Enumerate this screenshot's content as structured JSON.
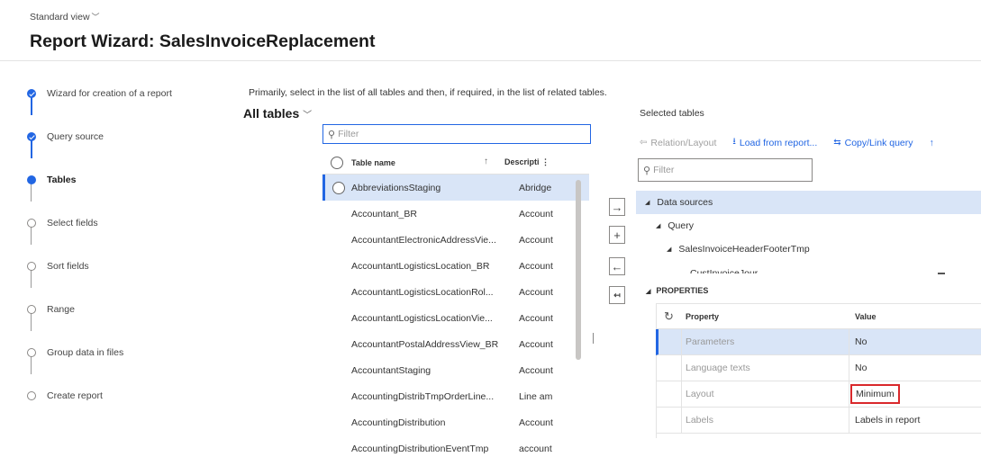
{
  "header": {
    "view_label": "Standard view",
    "title": "Report Wizard: SalesInvoiceReplacement"
  },
  "steps": [
    {
      "label": "Wizard for creation of a report",
      "state": "done"
    },
    {
      "label": "Query source",
      "state": "done"
    },
    {
      "label": "Tables",
      "state": "current"
    },
    {
      "label": "Select fields",
      "state": "todo"
    },
    {
      "label": "Sort fields",
      "state": "todo"
    },
    {
      "label": "Range",
      "state": "todo"
    },
    {
      "label": "Group data in files",
      "state": "todo"
    },
    {
      "label": "Create report",
      "state": "todo"
    }
  ],
  "tables": {
    "instructions": "Primarily, select in the list of all tables and then, if required, in the list of related tables.",
    "all_tables_label": "All tables",
    "filter_placeholder": "Filter",
    "col_name": "Table name",
    "col_desc": "Descripti",
    "rows": [
      {
        "name": "AbbreviationsStaging",
        "desc": "Abridge"
      },
      {
        "name": "Accountant_BR",
        "desc": "Account"
      },
      {
        "name": "AccountantElectronicAddressVie...",
        "desc": "Account"
      },
      {
        "name": "AccountantLogisticsLocation_BR",
        "desc": "Account"
      },
      {
        "name": "AccountantLogisticsLocationRol...",
        "desc": "Account"
      },
      {
        "name": "AccountantLogisticsLocationVie...",
        "desc": "Account"
      },
      {
        "name": "AccountantPostalAddressView_BR",
        "desc": "Account"
      },
      {
        "name": "AccountantStaging",
        "desc": "Account"
      },
      {
        "name": "AccountingDistribTmpOrderLine...",
        "desc": "Line am"
      },
      {
        "name": "AccountingDistribution",
        "desc": "Account"
      },
      {
        "name": "AccountingDistributionEventTmp",
        "desc": "account"
      }
    ]
  },
  "move_buttons": {
    "add": "→",
    "add_all": "+",
    "remove": "←",
    "remove_all": "↤"
  },
  "selected": {
    "label": "Selected tables",
    "toolbar": {
      "relation_layout": "Relation/Layout",
      "load_from_report": "Load from report...",
      "copy_link_query": "Copy/Link query"
    },
    "filter_placeholder": "Filter",
    "tree": {
      "data_sources": "Data sources",
      "query": "Query",
      "table": "SalesInvoiceHeaderFooterTmp",
      "child": "CustInvoiceJour"
    }
  },
  "properties": {
    "title": "PROPERTIES",
    "col_property": "Property",
    "col_value": "Value",
    "rows": [
      {
        "name": "Parameters",
        "value": "No"
      },
      {
        "name": "Language texts",
        "value": "No"
      },
      {
        "name": "Layout",
        "value": "Minimum"
      },
      {
        "name": "Labels",
        "value": "Labels in report"
      }
    ]
  },
  "colors": {
    "accent": "#2266e3",
    "selection": "#d9e5f7",
    "highlight_border": "#d9282b"
  }
}
